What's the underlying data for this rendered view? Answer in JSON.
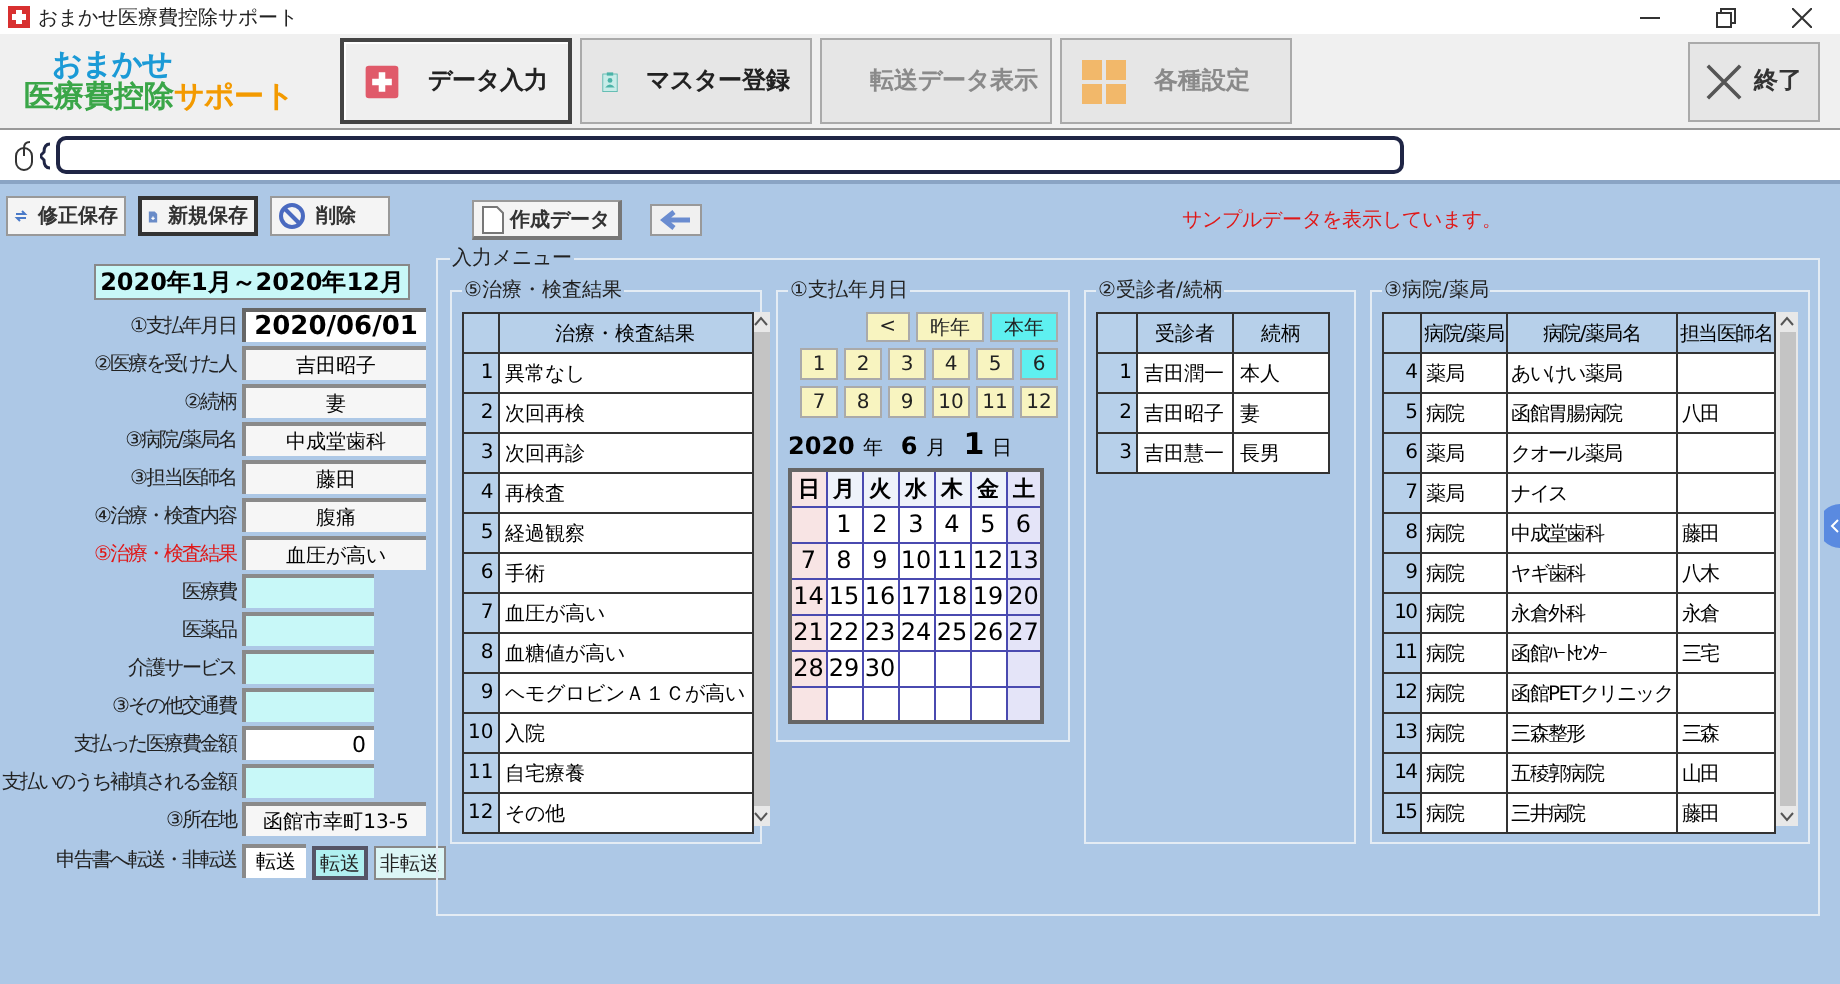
{
  "window": {
    "title": "おまかせ医療費控除サポート"
  },
  "logo": {
    "line1": "おまかせ",
    "line2": "医療費控除",
    "line2_accent": "サポート"
  },
  "toolbar": [
    {
      "label": "データ入力",
      "kind": "input",
      "selected": true,
      "disabled": false
    },
    {
      "label": "マスター登録",
      "kind": "master",
      "selected": false,
      "disabled": false
    },
    {
      "label": "転送データ表示",
      "kind": "transfer",
      "selected": false,
      "disabled": true
    },
    {
      "label": "各種設定",
      "kind": "settings",
      "selected": false,
      "disabled": true
    }
  ],
  "exit_button": {
    "label": "終了"
  },
  "actions": [
    {
      "label": "修正保存",
      "kind": "update",
      "selected": false
    },
    {
      "label": "新規保存",
      "kind": "new",
      "selected": true
    },
    {
      "label": "削除",
      "kind": "delete",
      "selected": false
    }
  ],
  "create_button": {
    "label": "作成データ"
  },
  "notice": "サンプルデータを表示しています。",
  "period": "2020年1月～2020年12月",
  "form": [
    {
      "label": "①支払年月日",
      "kind": "date",
      "value": "2020/06/01",
      "highlight": false
    },
    {
      "label": "②医療を受けた人",
      "kind": "text",
      "value": "吉田昭子",
      "highlight": false
    },
    {
      "label": "②続柄",
      "kind": "text",
      "value": "妻",
      "highlight": false
    },
    {
      "label": "③病院/薬局名",
      "kind": "text",
      "value": "中成堂歯科",
      "highlight": false
    },
    {
      "label": "③担当医師名",
      "kind": "text",
      "value": "藤田",
      "highlight": false
    },
    {
      "label": "④治療・検査内容",
      "kind": "text",
      "value": "腹痛",
      "highlight": false
    },
    {
      "label": "⑤治療・検査結果",
      "kind": "text",
      "value": "血圧が高い",
      "highlight": true
    },
    {
      "label": "医療費",
      "kind": "amount",
      "highlight": false
    },
    {
      "label": "医薬品",
      "kind": "amount",
      "highlight": false
    },
    {
      "label": "介護サービス",
      "kind": "amount",
      "highlight": false
    },
    {
      "label": "③その他交通費",
      "kind": "amount",
      "highlight": false
    },
    {
      "label": "支払った医療費金額",
      "kind": "amount",
      "value": "0",
      "highlight": false
    },
    {
      "label": "支払いのうち補填される金額",
      "kind": "amount",
      "highlight": false
    },
    {
      "label": "③所在地",
      "kind": "text",
      "value": "函館市幸町13-5",
      "highlight": false
    },
    {
      "label": "申告書へ転送・非転送",
      "kind": "transfer",
      "value": "転送",
      "highlight": false,
      "options": [
        {
          "label": "転送",
          "selected": true
        },
        {
          "label": "非転送",
          "selected": false
        }
      ]
    }
  ],
  "input_menu": {
    "title": "入力メニュー",
    "results": {
      "title": "⑤治療・検査結果",
      "column": "治療・検査結果",
      "rows": [
        {
          "no": "1",
          "text": "異常なし"
        },
        {
          "no": "2",
          "text": "次回再検"
        },
        {
          "no": "3",
          "text": "次回再診"
        },
        {
          "no": "4",
          "text": "再検査"
        },
        {
          "no": "5",
          "text": "経過観察"
        },
        {
          "no": "6",
          "text": "手術"
        },
        {
          "no": "7",
          "text": "血圧が高い"
        },
        {
          "no": "8",
          "text": "血糖値が高い"
        },
        {
          "no": "9",
          "text": "ヘモグロビンＡ１Ｃが高い"
        },
        {
          "no": "10",
          "text": "入院"
        },
        {
          "no": "11",
          "text": "自宅療養"
        },
        {
          "no": "12",
          "text": "その他"
        }
      ]
    },
    "calendar": {
      "title": "①支払年月日",
      "nav": [
        {
          "label": "<",
          "selected": false
        },
        {
          "label": "昨年",
          "selected": false
        },
        {
          "label": "本年",
          "selected": true
        }
      ],
      "months": [
        {
          "label": "1",
          "selected": false
        },
        {
          "label": "2",
          "selected": false
        },
        {
          "label": "3",
          "selected": false
        },
        {
          "label": "4",
          "selected": false
        },
        {
          "label": "5",
          "selected": false
        },
        {
          "label": "6",
          "selected": true
        },
        {
          "label": "7",
          "selected": false
        },
        {
          "label": "8",
          "selected": false
        },
        {
          "label": "9",
          "selected": false
        },
        {
          "label": "10",
          "selected": false
        },
        {
          "label": "11",
          "selected": false
        },
        {
          "label": "12",
          "selected": false
        }
      ],
      "year": "2020",
      "year_unit": "年",
      "month": "6",
      "month_unit": "月",
      "day": "1",
      "day_unit": "日",
      "weekdays": [
        "日",
        "月",
        "火",
        "水",
        "木",
        "金",
        "土"
      ],
      "weeks": [
        [
          {
            "kind": "blank"
          },
          {
            "kind": "day",
            "label": "1"
          },
          {
            "kind": "day",
            "label": "2"
          },
          {
            "kind": "day",
            "label": "3"
          },
          {
            "kind": "day",
            "label": "4"
          },
          {
            "kind": "day",
            "label": "5"
          },
          {
            "kind": "day",
            "label": "6"
          }
        ],
        [
          {
            "kind": "day",
            "label": "7"
          },
          {
            "kind": "day",
            "label": "8"
          },
          {
            "kind": "day",
            "label": "9"
          },
          {
            "kind": "day",
            "label": "10"
          },
          {
            "kind": "day",
            "label": "11"
          },
          {
            "kind": "day",
            "label": "12"
          },
          {
            "kind": "day",
            "label": "13"
          }
        ],
        [
          {
            "kind": "day",
            "label": "14"
          },
          {
            "kind": "day",
            "label": "15"
          },
          {
            "kind": "day",
            "label": "16"
          },
          {
            "kind": "day",
            "label": "17"
          },
          {
            "kind": "day",
            "label": "18"
          },
          {
            "kind": "day",
            "label": "19"
          },
          {
            "kind": "day",
            "label": "20"
          }
        ],
        [
          {
            "kind": "day",
            "label": "21"
          },
          {
            "kind": "day",
            "label": "22"
          },
          {
            "kind": "day",
            "label": "23"
          },
          {
            "kind": "day",
            "label": "24"
          },
          {
            "kind": "day",
            "label": "25"
          },
          {
            "kind": "day",
            "label": "26"
          },
          {
            "kind": "day",
            "label": "27"
          }
        ],
        [
          {
            "kind": "day",
            "label": "28"
          },
          {
            "kind": "day",
            "label": "29"
          },
          {
            "kind": "day",
            "label": "30"
          },
          {
            "kind": "blank"
          },
          {
            "kind": "blank"
          },
          {
            "kind": "blank"
          },
          {
            "kind": "blank"
          }
        ],
        [
          {
            "kind": "blank"
          },
          {
            "kind": "blank"
          },
          {
            "kind": "blank"
          },
          {
            "kind": "blank"
          },
          {
            "kind": "blank"
          },
          {
            "kind": "blank"
          },
          {
            "kind": "blank"
          }
        ]
      ]
    },
    "patients": {
      "title": "②受診者/続柄",
      "columns": [
        "受診者",
        "続柄"
      ],
      "rows": [
        {
          "no": "1",
          "cells": [
            "吉田潤一",
            "本人"
          ]
        },
        {
          "no": "2",
          "cells": [
            "吉田昭子",
            "妻"
          ]
        },
        {
          "no": "3",
          "cells": [
            "吉田慧一",
            "長男"
          ]
        }
      ]
    },
    "hospitals": {
      "title": "③病院/薬局",
      "columns": [
        "病院/薬局",
        "病院/薬局名",
        "担当医師名"
      ],
      "rows": [
        {
          "no": "4",
          "cells": [
            "薬局",
            "あいけい薬局"
          ]
        },
        {
          "no": "5",
          "cells": [
            "病院",
            "函館胃腸病院",
            "八田"
          ]
        },
        {
          "no": "6",
          "cells": [
            "薬局",
            "クオール薬局"
          ]
        },
        {
          "no": "7",
          "cells": [
            "薬局",
            "ナイス"
          ]
        },
        {
          "no": "8",
          "cells": [
            "病院",
            "中成堂歯科",
            "藤田"
          ]
        },
        {
          "no": "9",
          "cells": [
            "病院",
            "ヤギ歯科",
            "八木"
          ]
        },
        {
          "no": "10",
          "cells": [
            "病院",
            "永倉外科",
            "永倉"
          ]
        },
        {
          "no": "11",
          "cells": [
            "病院",
            "函館ﾊｰﾄｾﾝﾀｰ",
            "三宅"
          ]
        },
        {
          "no": "12",
          "cells": [
            "病院",
            "函館PETクリニック"
          ]
        },
        {
          "no": "13",
          "cells": [
            "病院",
            "三森整形",
            "三森"
          ]
        },
        {
          "no": "14",
          "cells": [
            "病院",
            "五稜郭病院",
            "山田"
          ]
        },
        {
          "no": "15",
          "cells": [
            "病院",
            "三井病院",
            "藤田"
          ]
        }
      ]
    }
  }
}
